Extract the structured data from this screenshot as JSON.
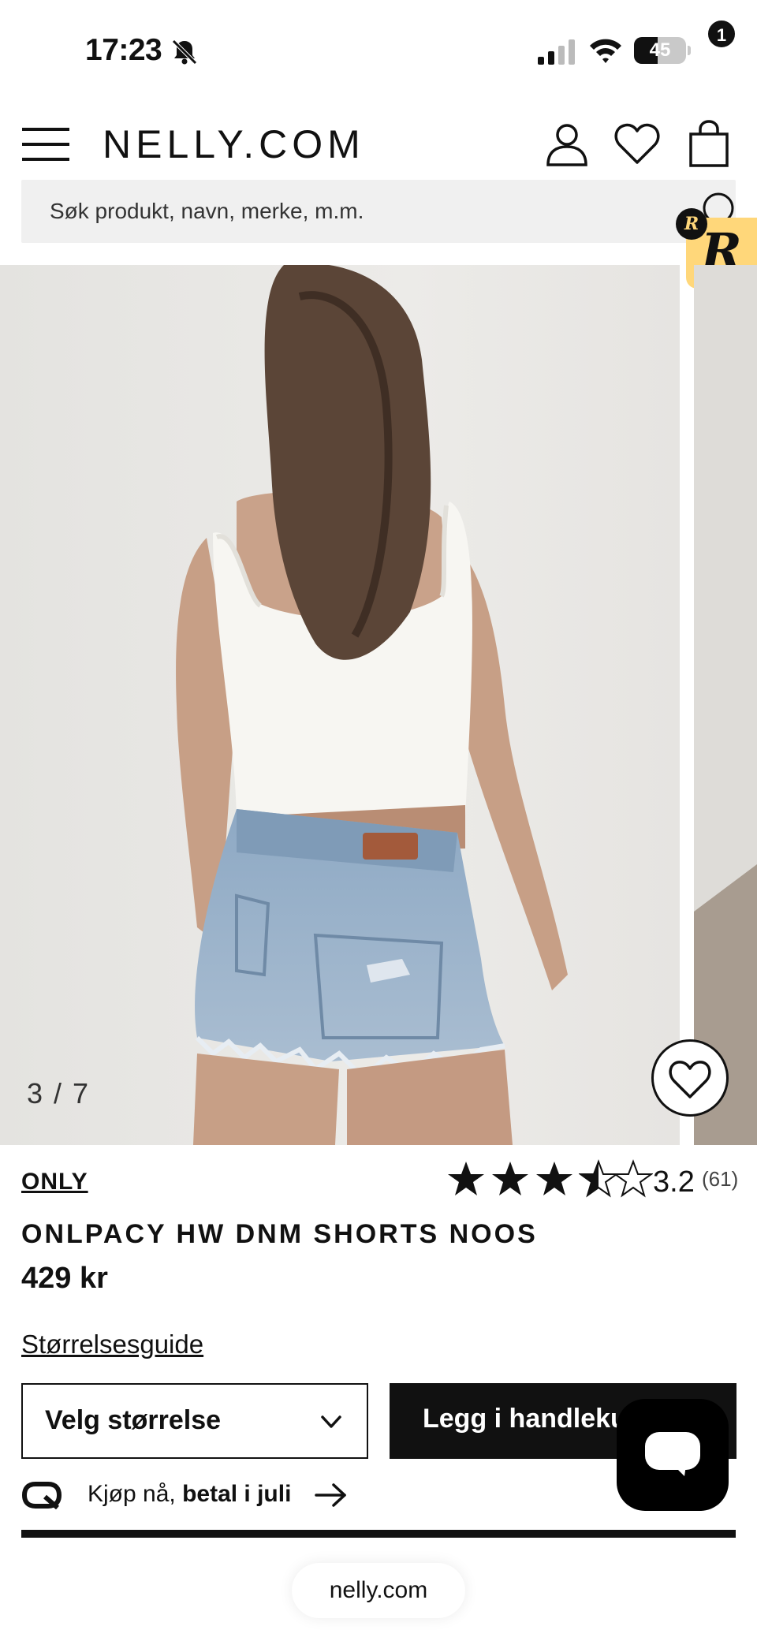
{
  "status_bar": {
    "time": "17:23",
    "battery": "45",
    "battery_level": 0.45,
    "icons": [
      "bell-slash-icon",
      "signal-icon",
      "wifi-icon",
      "battery-icon"
    ]
  },
  "header": {
    "logo": "NELLY.COM",
    "icons": [
      "menu-icon",
      "account-icon",
      "wishlist-icon",
      "shopping-bag-icon"
    ],
    "bag_count": "1"
  },
  "search": {
    "placeholder": "Søk produkt, navn, merke, m.m."
  },
  "gallery": {
    "counter": "3 / 7",
    "current": 3,
    "total": 7
  },
  "product": {
    "brand": "ONLY",
    "rating_value": "3.2",
    "rating_count": "(61)",
    "stars_filled": 3.5,
    "stars_total": 5,
    "title": "ONLPACY HW DNM SHORTS NOOS",
    "price": "429 kr"
  },
  "actions": {
    "size_guide": "Størrelsesguide",
    "size_select": "Velg størrelse",
    "add_to_cart": "Legg i handlekurv"
  },
  "klarna": {
    "text_plain": "Kjøp nå, ",
    "text_bold": "betal i juli"
  },
  "browser": {
    "url": "nelly.com"
  },
  "colors": {
    "text": "#111111",
    "badge_yellow": "#ffd77a",
    "search_bg": "#f0f0f0",
    "image_bg": "#e9e8e5"
  }
}
